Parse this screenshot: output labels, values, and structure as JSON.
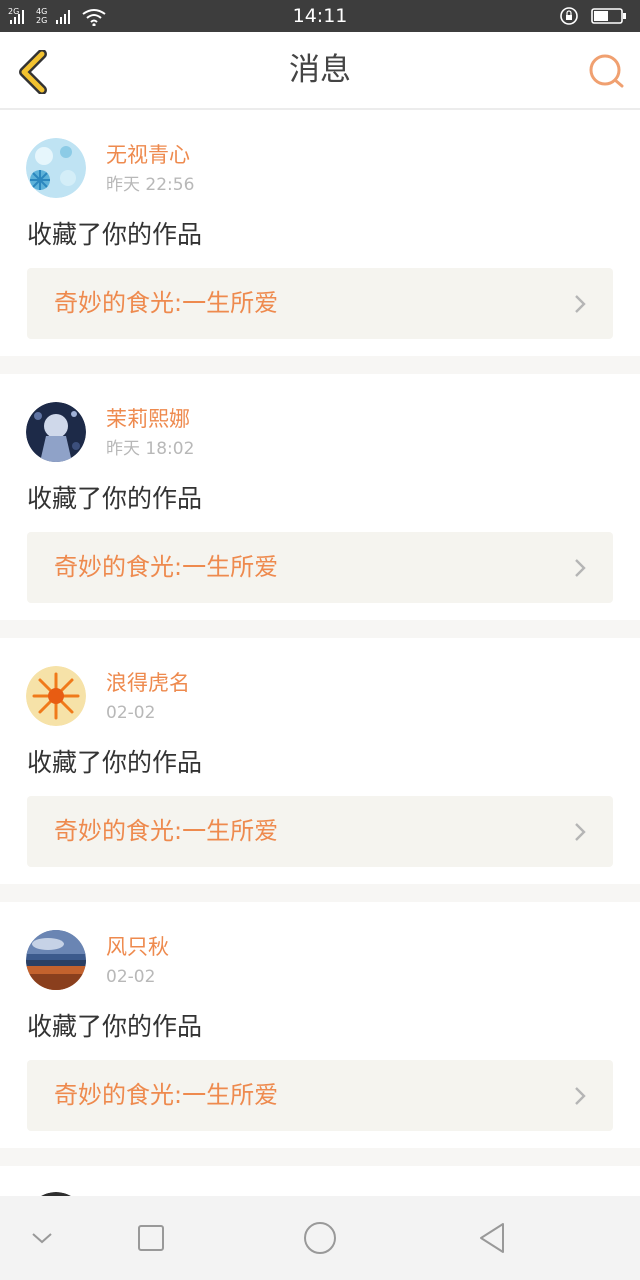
{
  "status_bar": {
    "time": "14:11",
    "network_labels": [
      "2G",
      "4G",
      "2G"
    ],
    "icons": [
      "signal-icon",
      "wifi-icon",
      "rotation-lock-icon",
      "battery-icon"
    ]
  },
  "header": {
    "title": "消息",
    "back_icon": "chevron-left-icon",
    "search_icon": "search-icon"
  },
  "notifications": [
    {
      "username": "无视青心",
      "time": "昨天 22:56",
      "action": "收藏了你的作品",
      "work_title": "奇妙的食光:一生所爱"
    },
    {
      "username": "茉莉熙娜",
      "time": "昨天 18:02",
      "action": "收藏了你的作品",
      "work_title": "奇妙的食光:一生所爱"
    },
    {
      "username": "浪得虎名",
      "time": "02-02",
      "action": "收藏了你的作品",
      "work_title": "奇妙的食光:一生所爱"
    },
    {
      "username": "风只秋",
      "time": "02-02",
      "action": "收藏了你的作品",
      "work_title": "奇妙的食光:一生所爱"
    }
  ],
  "bottom_nav": [
    "chevron-down-icon",
    "recents-square-icon",
    "home-circle-icon",
    "back-triangle-icon"
  ],
  "colors": {
    "accent": "#ee8a4e",
    "back_icon": "#f2c230",
    "text": "#333333",
    "muted": "#b8b8b8",
    "link_bg": "#f5f4ef",
    "page_bg": "#f7f6f4"
  }
}
